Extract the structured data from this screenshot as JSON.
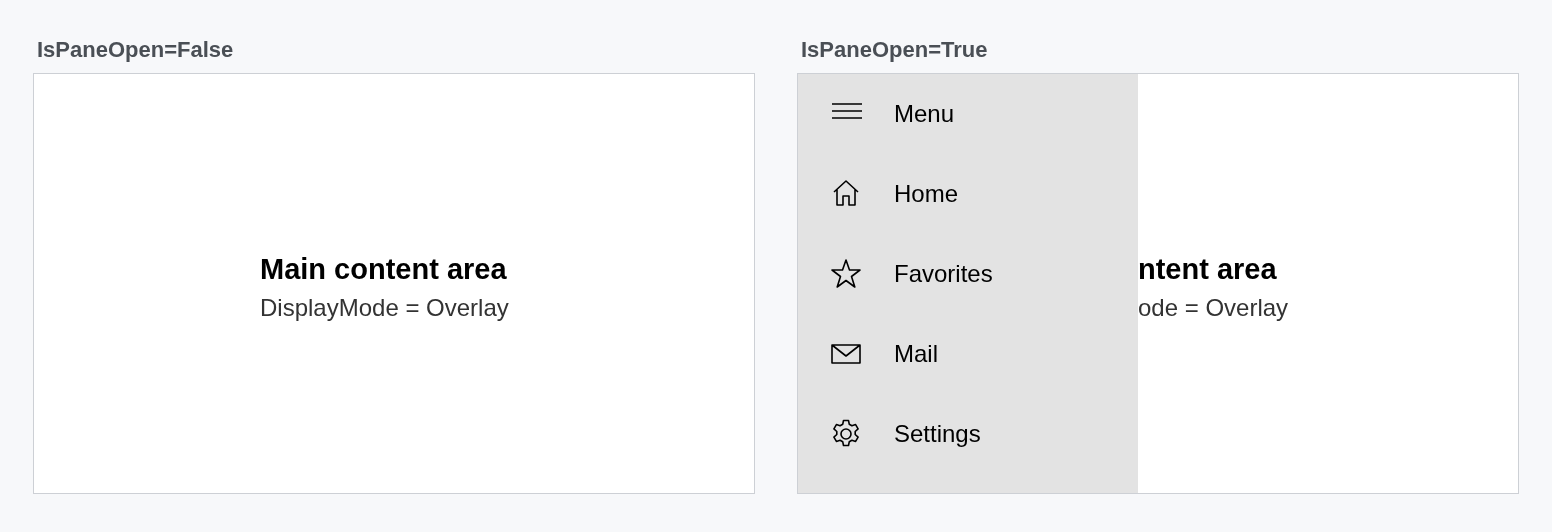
{
  "panels": [
    {
      "caption": "IsPaneOpen=False",
      "pane_open": false,
      "content": {
        "title": "Main content area",
        "subtitle": "DisplayMode = Overlay"
      }
    },
    {
      "caption": "IsPaneOpen=True",
      "pane_open": true,
      "pane": {
        "items": [
          "Menu",
          "Home",
          "Favorites",
          "Mail",
          "Settings"
        ]
      },
      "content": {
        "title": "ntent area",
        "subtitle": "ode = Overlay"
      }
    }
  ]
}
